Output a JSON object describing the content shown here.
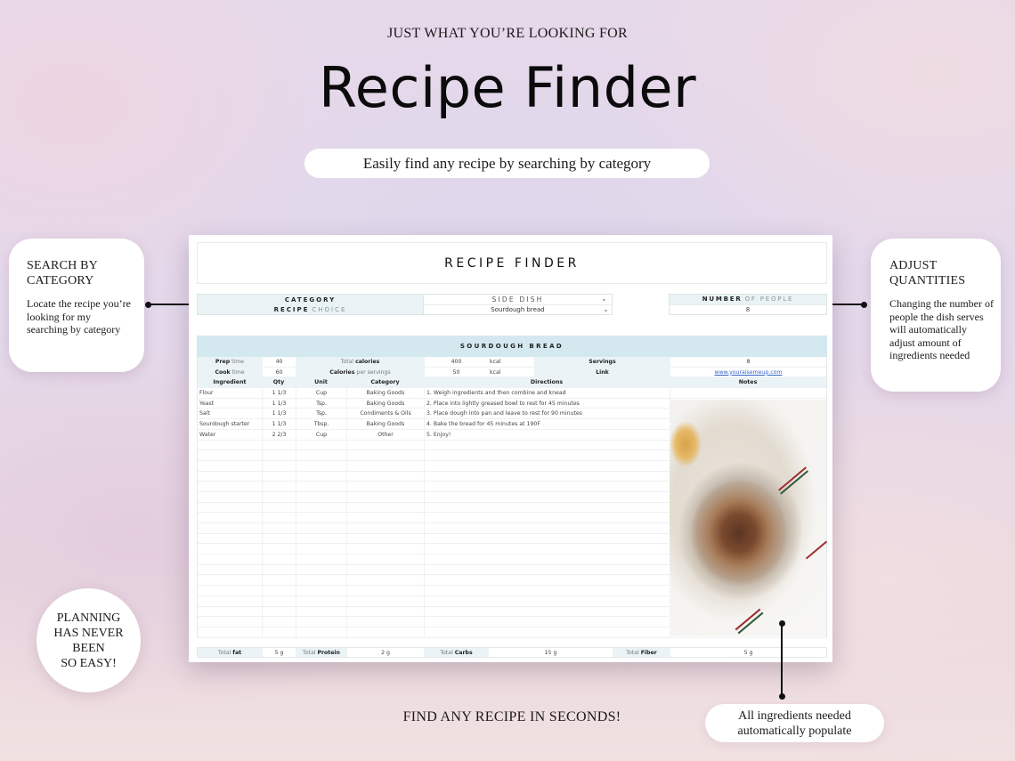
{
  "hero": {
    "eyebrow": "JUST WHAT YOU’RE LOOKING FOR",
    "title": "Recipe Finder",
    "subtitle": "Easily find any recipe by searching by category"
  },
  "callouts": {
    "left": {
      "heading_line1": "SEARCH BY",
      "heading_line2": "CATEGORY",
      "body": "Locate the recipe you’re looking for my searching by category"
    },
    "right": {
      "heading_line1": "ADJUST",
      "heading_line2": "QUANTITIES",
      "body": "Changing the number of people the dish serves will automatically adjust amount of ingredients needed"
    },
    "badge": [
      "PLANNING",
      "HAS NEVER",
      "BEEN",
      "SO EASY!"
    ],
    "bottom_pill": [
      "All ingredients needed",
      "automatically populate"
    ]
  },
  "footer": {
    "text": "FIND ANY RECIPE IN SECONDS!"
  },
  "sheet": {
    "title": "RECIPE FINDER",
    "selector": {
      "category_label": "CATEGORY",
      "recipe_label_bold": "RECIPE",
      "recipe_label_light": "CHOICE",
      "category_value": "SIDE DISH",
      "recipe_value": "Sourdough bread",
      "dropdown_glyph": "▾"
    },
    "people": {
      "label_bold": "NUMBER",
      "label_light": "OF PEOPLE",
      "value": "8"
    },
    "recipe_name": "SOURDOUGH BREAD",
    "info": {
      "prep_bold": "Prep",
      "prep_light": "time",
      "prep_value": "40",
      "cook_bold": "Cook",
      "cook_light": "time",
      "cook_value": "60",
      "total_cal_light": "Total",
      "total_cal_bold": "calories",
      "total_cal_value": "400",
      "total_cal_unit": "kcal",
      "cal_serv_bold": "Calories",
      "cal_serv_light": "per servings",
      "cal_serv_value": "50",
      "cal_serv_unit": "kcal",
      "servings_label": "Servings",
      "servings_value": "8",
      "link_label": "Link",
      "link_value": "www.youraisemeup.com"
    },
    "columns": {
      "ingredient": "Ingredient",
      "qty": "Qty",
      "unit": "Unit",
      "category": "Category",
      "directions": "Directions",
      "notes": "Notes"
    },
    "ingredients": [
      {
        "name": "Flour",
        "qty": "1 1/3",
        "unit": "Cup",
        "category": "Baking Goods"
      },
      {
        "name": "Yeast",
        "qty": "1 1/3",
        "unit": "Tsp.",
        "category": "Baking Goods"
      },
      {
        "name": "Salt",
        "qty": "1 1/3",
        "unit": "Tsp.",
        "category": "Condiments & Oils"
      },
      {
        "name": "Sourdough starter",
        "qty": "1 1/3",
        "unit": "Tbsp.",
        "category": "Baking Goods"
      },
      {
        "name": "Water",
        "qty": "2 2/3",
        "unit": "Cup",
        "category": "Other"
      }
    ],
    "directions": [
      "1. Weigh ingredients and then combine and knead",
      "2. Place into lightly greased bowl to rest for 45 minutes",
      "3. Place dough into pan and leave to rest for 90 minutes",
      "4. Bake the bread for 45 minutes at 190F",
      "5. Enjoy!"
    ],
    "notes_image": "sourdough-bread-photo",
    "totals": {
      "fat_light": "Total",
      "fat_bold": "fat",
      "fat_value": "5 g",
      "protein_light": "Total",
      "protein_bold": "Protein",
      "protein_value": "2 g",
      "carbs_light": "Total",
      "carbs_bold": "Carbs",
      "carbs_value": "15 g",
      "fiber_light": "Total",
      "fiber_bold": "Fiber",
      "fiber_value": "5 g"
    }
  }
}
